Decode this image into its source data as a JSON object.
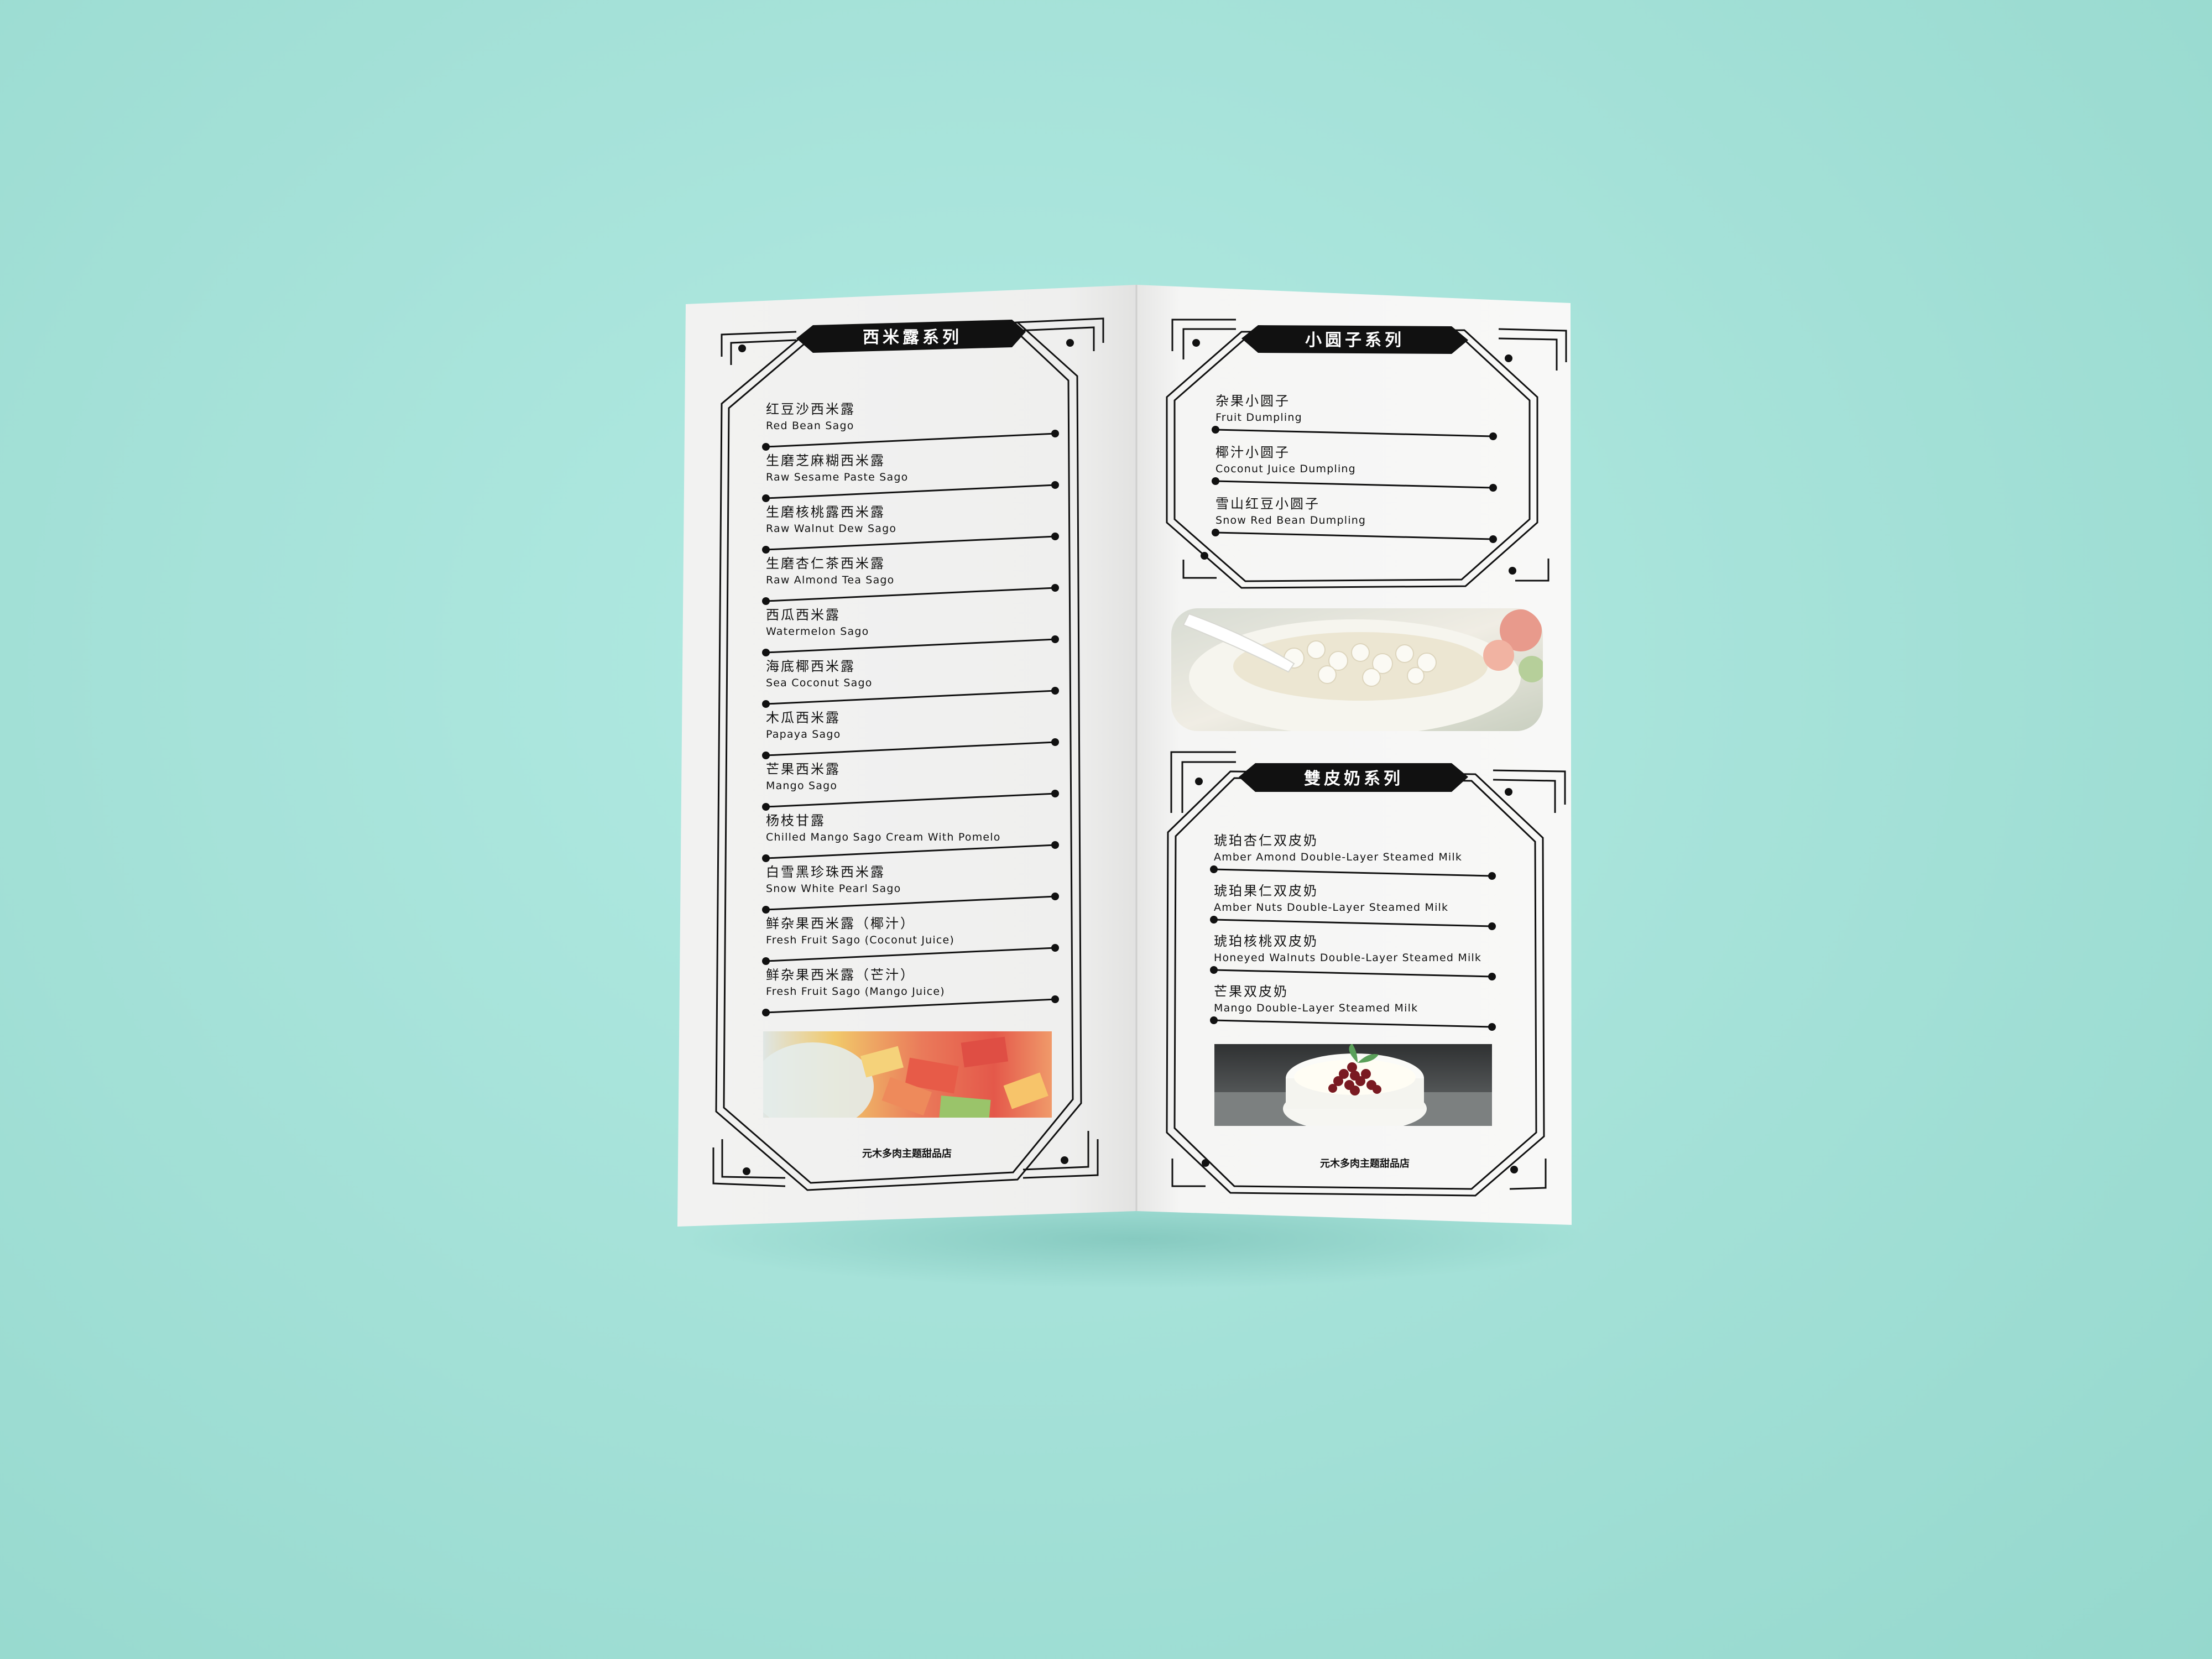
{
  "left_panel": {
    "section_title": "西米露系列",
    "items": [
      {
        "zh": "红豆沙西米露",
        "en": "Red Bean Sago"
      },
      {
        "zh": "生磨芝麻糊西米露",
        "en": "Raw Sesame Paste Sago"
      },
      {
        "zh": "生磨核桃露西米露",
        "en": "Raw Walnut Dew Sago"
      },
      {
        "zh": "生磨杏仁茶西米露",
        "en": "Raw Almond Tea Sago"
      },
      {
        "zh": "西瓜西米露",
        "en": "Watermelon Sago"
      },
      {
        "zh": "海底椰西米露",
        "en": "Sea Coconut Sago"
      },
      {
        "zh": "木瓜西米露",
        "en": "Papaya Sago"
      },
      {
        "zh": "芒果西米露",
        "en": "Mango Sago"
      },
      {
        "zh": "杨枝甘露",
        "en": "Chilled Mango Sago Cream With Pomelo"
      },
      {
        "zh": "白雪黑珍珠西米露",
        "en": "Snow White Pearl Sago"
      },
      {
        "zh": "鲜杂果西米露（椰汁）",
        "en": "Fresh Fruit Sago (Coconut Juice)"
      },
      {
        "zh": "鲜杂果西米露（芒汁）",
        "en": "Fresh Fruit Sago (Mango Juice)"
      }
    ],
    "footer": "元木多肉主题甜品店"
  },
  "right_panel": {
    "section1_title": "小圆子系列",
    "section1_items": [
      {
        "zh": "杂果小圆子",
        "en": "Fruit Dumpling"
      },
      {
        "zh": "椰汁小圆子",
        "en": "Coconut Juice Dumpling"
      },
      {
        "zh": "雪山红豆小圆子",
        "en": "Snow Red Bean Dumpling"
      }
    ],
    "section2_title": "雙皮奶系列",
    "section2_items": [
      {
        "zh": "琥珀杏仁双皮奶",
        "en": "Amber Amond Double-Layer Steamed Milk"
      },
      {
        "zh": "琥珀果仁双皮奶",
        "en": "Amber Nuts Double-Layer Steamed Milk"
      },
      {
        "zh": "琥珀核桃双皮奶",
        "en": "Honeyed Walnuts Double-Layer Steamed Milk"
      },
      {
        "zh": "芒果双皮奶",
        "en": "Mango Double-Layer Steamed Milk"
      }
    ],
    "footer": "元木多肉主题甜品店"
  },
  "colors": {
    "background": "#a8e3da",
    "paper": "#f4f4f3",
    "ink": "#111111"
  }
}
